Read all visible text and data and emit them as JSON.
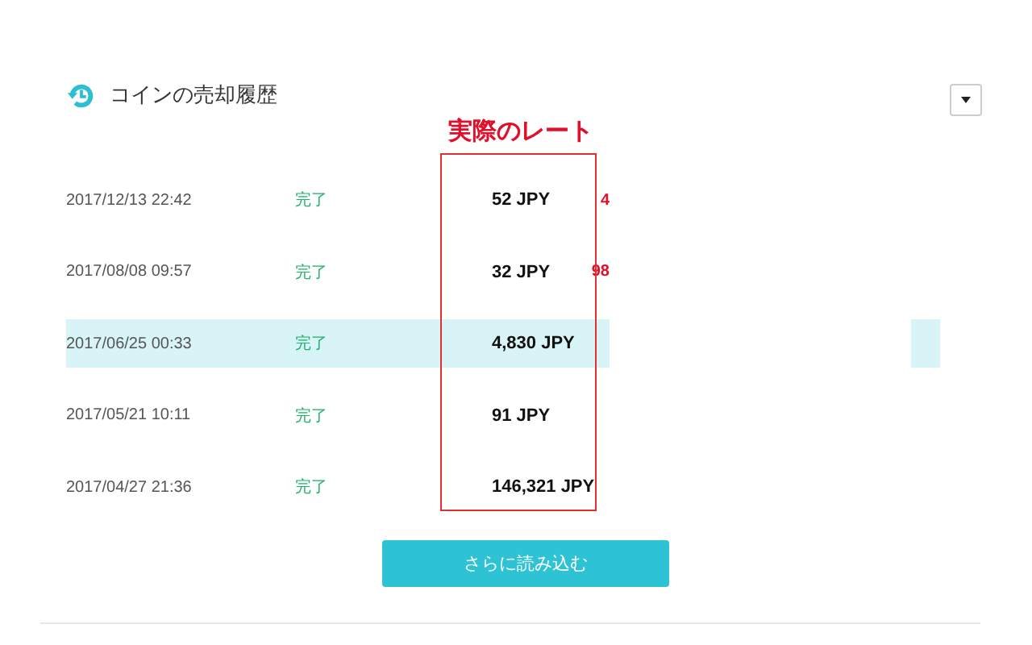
{
  "header": {
    "title": "コインの売却履歴"
  },
  "annotation": {
    "label": "実際のレート"
  },
  "rows": [
    {
      "date": "2017/12/13 22:42",
      "status": "完了",
      "amount": "52 JPY",
      "column_4": "4",
      "selected": false
    },
    {
      "date": "2017/08/08 09:57",
      "status": "完了",
      "amount": "32 JPY",
      "column_4": "98",
      "selected": false
    },
    {
      "date": "2017/06/25 00:33",
      "status": "完了",
      "amount": "4,830 JPY",
      "selected": true
    },
    {
      "date": "2017/05/21 10:11",
      "status": "完了",
      "amount": "91 JPY",
      "selected": false
    },
    {
      "date": "2017/04/27 21:36",
      "status": "完了",
      "amount": "146,321 JPY",
      "selected": false
    }
  ],
  "load_more": {
    "label": "さらに読み込む"
  }
}
